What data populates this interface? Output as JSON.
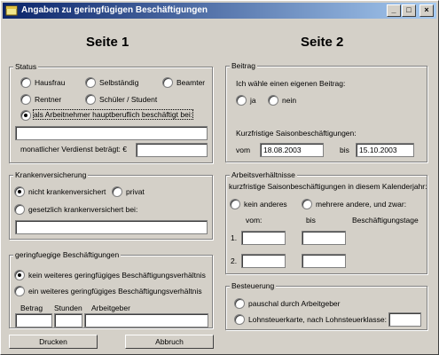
{
  "window": {
    "title": "Angaben zu geringfügigen Beschäftigungen",
    "btn_min": "_",
    "btn_max": "□",
    "btn_close": "×"
  },
  "page1": {
    "heading": "Seite 1"
  },
  "page2": {
    "heading": "Seite 2"
  },
  "status": {
    "legend": "Status",
    "opt_hausfrau": "Hausfrau",
    "opt_selbstaendig": "Selbständig",
    "opt_beamter": "Beamter",
    "opt_rentner": "Rentner",
    "opt_schueler": "Schüler / Student",
    "opt_arbeitnehmer": "als Arbeitnehmer hauptberuflich beschäftigt bei:",
    "employer_value": "",
    "verdienst_label": "monatlicher Verdienst beträgt: €",
    "verdienst_value": ""
  },
  "kranken": {
    "legend": "Krankenversicherung",
    "opt_nicht": "nicht krankenversichert",
    "opt_privat": "privat",
    "opt_gesetzlich": "gesetzlich krankenversichert bei:",
    "kasse_value": ""
  },
  "geringfuegig": {
    "legend": "geringfuegige Beschäftigungen",
    "opt_kein": "kein weiteres geringfügiges Beschäftigungsverhältnis",
    "opt_ein": "ein weiteres geringfügiges Beschäftigungsverhältnis",
    "col_betrag": "Betrag",
    "col_stunden": "Stunden",
    "col_arbeitgeber": "Arbeitgeber"
  },
  "beitrag": {
    "legend": "Beitrag",
    "question": "Ich wähle einen eigenen Beitrag:",
    "opt_ja": "ja",
    "opt_nein": "nein",
    "saison_label": "Kurzfristige Saisonbeschäftigungen:",
    "vom_label": "vom",
    "vom_value": "18.08.2003",
    "bis_label": "bis",
    "bis_value": "15.10.2003"
  },
  "arbeits": {
    "legend": "Arbeitsverhältnisse",
    "subtitle": "kurzfristige Saisonbeschäftigungen in diesem Kalenderjahr:",
    "opt_kein": "kein anderes",
    "opt_mehrere": "mehrere andere, und zwar:",
    "col_vom": "vom:",
    "col_bis": "bis",
    "col_tage": "Beschäftigungstage",
    "row1": "1.",
    "row2": "2."
  },
  "steuer": {
    "legend": "Besteuerung",
    "opt_pauschal": "pauschal durch Arbeitgeber",
    "opt_karte": "Lohnsteuerkarte, nach Lohnsteuerklasse:"
  },
  "buttons": {
    "drucken": "Drucken",
    "abbruch": "Abbruch"
  }
}
